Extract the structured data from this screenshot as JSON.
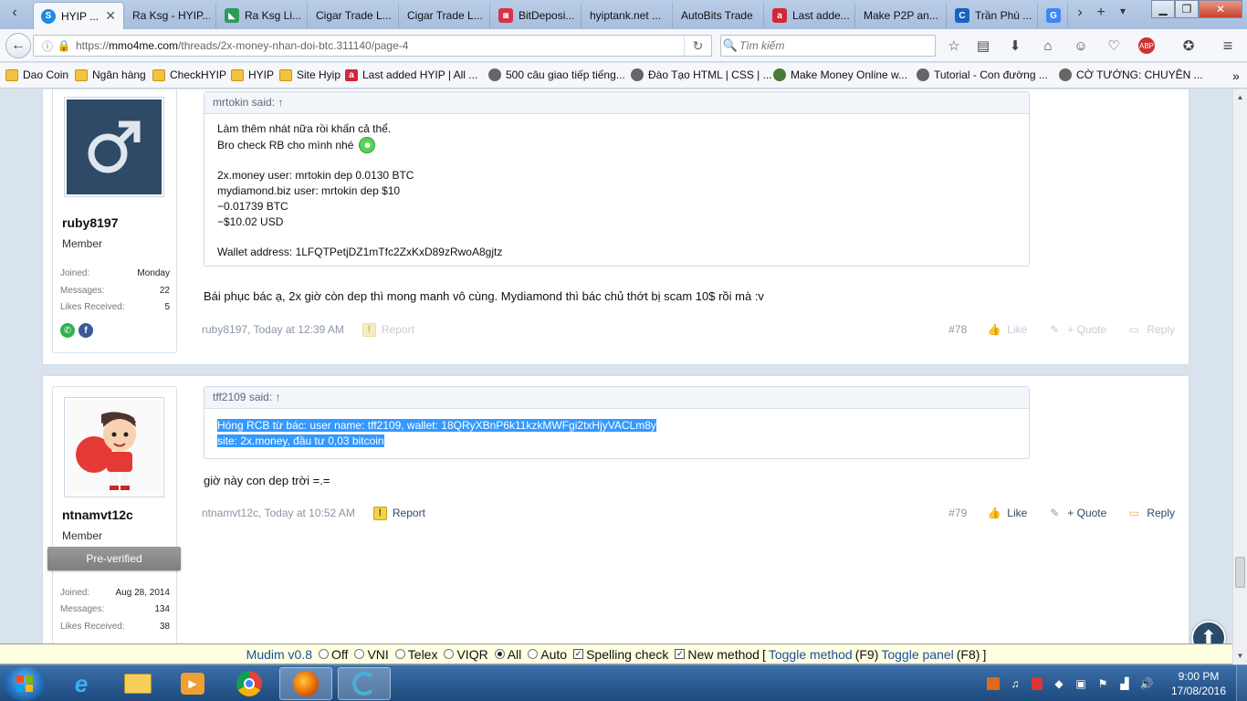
{
  "tabs": [
    {
      "label": "HYIP ...",
      "favicon_color": "#1e88e5",
      "favicon_glyph": "S",
      "active": true
    },
    {
      "label": "Ra Ksg - HYIP...",
      "favicon_color": "#3a6fb0",
      "favicon_glyph": "‹"
    },
    {
      "label": "Ra Ksg Li...",
      "favicon_color": "#2e9a57",
      "favicon_glyph": "◣"
    },
    {
      "label": "Cigar Trade L...",
      "favicon_color": "",
      "favicon_glyph": ""
    },
    {
      "label": "Cigar Trade L...",
      "favicon_color": "",
      "favicon_glyph": ""
    },
    {
      "label": "BitDeposi...",
      "favicon_color": "#d8334a",
      "favicon_glyph": "◙"
    },
    {
      "label": "hyiptank.net ...",
      "favicon_color": "",
      "favicon_glyph": ""
    },
    {
      "label": "AutoBits Trade",
      "favicon_color": "",
      "favicon_glyph": ""
    },
    {
      "label": "Last adde...",
      "favicon_color": "#d0283a",
      "favicon_glyph": "a"
    },
    {
      "label": "Make P2P an...",
      "favicon_color": "",
      "favicon_glyph": ""
    },
    {
      "label": "Trần Phú ...",
      "favicon_color": "#1565c0",
      "favicon_glyph": "C"
    },
    {
      "label": "G",
      "favicon_color": "#4285f4",
      "favicon_glyph": "G"
    }
  ],
  "nav": {
    "url_prefix": "https://",
    "url_host": "mmo4me.com",
    "url_path": "/threads/2x-money-nhan-doi-btc.311140/page-4",
    "search_placeholder": "Tìm kiếm"
  },
  "bookmarks": [
    {
      "label": "Dao Coin",
      "icon": "folder"
    },
    {
      "label": "Ngân hàng",
      "icon": "folder"
    },
    {
      "label": "CheckHYIP",
      "icon": "folder"
    },
    {
      "label": "HYIP",
      "icon": "folder"
    },
    {
      "label": "Site Hyip",
      "icon": "folder"
    },
    {
      "label": "Last added HYIP | All ...",
      "icon": "red-a"
    },
    {
      "label": "500 câu giao tiếp tiếng...",
      "icon": "globe"
    },
    {
      "label": "Đào Tạo HTML | CSS | ...",
      "icon": "globe"
    },
    {
      "label": "Make Money Online w...",
      "icon": "globe"
    },
    {
      "label": "Tutorial - Con đường ...",
      "icon": "globe"
    },
    {
      "label": "CỜ TƯỚNG: CHUYÊN ...",
      "icon": "globe"
    }
  ],
  "posts": [
    {
      "username": "ruby8197",
      "user_title": "Member",
      "stats": [
        {
          "label": "Joined:",
          "value": "Monday"
        },
        {
          "label": "Messages:",
          "value": "22"
        },
        {
          "label": "Likes Received:",
          "value": "5"
        }
      ],
      "quote_author": "mrtokin said: ↑",
      "quote_lines": [
        "Làm thêm nhát nữa rồi khấn cả thể.",
        "Bro check RB cho mình nhé",
        "",
        "2x.money user: mrtokin dep 0.0130 BTC",
        "mydiamond.biz user: mrtokin dep $10",
        "−0.01739 BTC",
        "−$10.02 USD",
        "",
        "Wallet address: 1LFQTPetjDZ1mTfc2ZxKxD89zRwoA8gjtz"
      ],
      "message": "Bái phục bác ạ, 2x giờ còn dep thì mong manh vô cùng. Mydiamond thì bác chủ thớt bị scam 10$ rồi mà :v",
      "meta_author": "ruby8197, Today at 12:39 AM",
      "report": "Report",
      "post_no": "#78",
      "like": "Like",
      "quote": "+ Quote",
      "reply": "Reply"
    },
    {
      "username": "ntnamvt12c",
      "user_title": "Member",
      "badge": "Pre-verified",
      "stats": [
        {
          "label": "Joined:",
          "value": "Aug 28, 2014"
        },
        {
          "label": "Messages:",
          "value": "134"
        },
        {
          "label": "Likes Received:",
          "value": "38"
        }
      ],
      "quote_author": "tff2109 said: ↑",
      "quote_lines": [
        "Hóng RCB từ bác: user name: tff2109, wallet: 18QRyXBnP6k11kzkMWFgi2txHjyVACLm8y",
        "site: 2x.money, đầu tư 0,03 bitcoin"
      ],
      "message": "giờ này con dep trời =.=",
      "meta_author": "ntnamvt12c, Today at 10:52 AM",
      "report": "Report",
      "post_no": "#79",
      "like": "Like",
      "quote": "+ Quote",
      "reply": "Reply"
    }
  ],
  "mudim": {
    "name": "Mudim v0.8",
    "options": [
      "Off",
      "VNI",
      "Telex",
      "VIQR",
      "All",
      "Auto"
    ],
    "selected": "All",
    "spelling": "Spelling check",
    "new_method": "New method",
    "bracket_open": "[",
    "toggle_method": "Toggle method",
    "toggle_method_key": "(F9)",
    "toggle_panel": "Toggle panel",
    "toggle_panel_key": "(F8)",
    "bracket_close": "]"
  },
  "clock": {
    "time": "9:00 PM",
    "date": "17/08/2016"
  },
  "colors": {
    "accent": "#2d4968",
    "selection": "#3399ff",
    "taskbar": "#1d4a7e"
  }
}
